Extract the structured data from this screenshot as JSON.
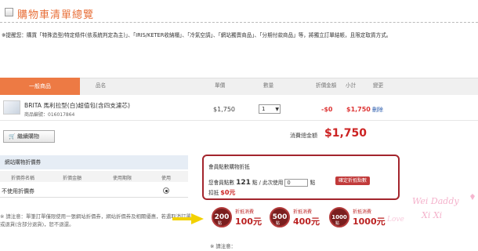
{
  "page": {
    "title": "購物車清單總覽",
    "notice": "※提醒您：購買「特殊造型/特定條件(依系統判定為主)」、「IRIS/KETER收納櫃」、「冷氣空調」、「網站獨賣商品」、「分期付款商品」等，將獨立訂單結帳，且限定取貨方式。"
  },
  "tabs": [
    {
      "label": "一般商品",
      "active": true
    }
  ],
  "table": {
    "headers": [
      "品名",
      "單價",
      "數量",
      "折價金額",
      "小計",
      "變更"
    ],
    "rows": [
      {
        "name": "BRITA 馬利拉型(白)超值包(含四支濾芯)",
        "code": "商品編號：016017864",
        "price": "$1,750",
        "qty": "1",
        "discount": "-$0",
        "subtotal": "$1,750",
        "action": "刪除"
      }
    ]
  },
  "cart": {
    "continue_label": "繼續購物",
    "total_label": "消費總金額",
    "total_value": "$1,750"
  },
  "coupon": {
    "title": "網站購物折價券",
    "headers": [
      "折價券名稱",
      "折價金額",
      "使用期限",
      "使用"
    ],
    "none_label": "不使用折價券",
    "note": "※ 請注意：單筆訂單僅限使用一張網站折價券，網站折價券及相關優惠，若遇取消訂單或退貨(含部分退貨)，恕不退還。"
  },
  "points": {
    "title": "會員點數購物折抵",
    "available_prefix": "您會員點數",
    "available_value": "121",
    "available_suffix": "點 / 此次使用",
    "input_value": "0",
    "input_suffix": "點",
    "confirm_label": "確定折抵點數",
    "deduct_prefix": "扣抵",
    "deduct_value": "$0元"
  },
  "rewards": [
    {
      "points": "200",
      "unit": "點",
      "text": "折抵消費",
      "amount": "100元"
    },
    {
      "points": "500",
      "unit": "點",
      "text": "折抵消費",
      "amount": "400元"
    },
    {
      "points": "1000",
      "unit": "點",
      "text": "折抵消費",
      "amount": "1000元"
    }
  ],
  "watermark": {
    "line1": "Wei Daddy",
    "line2": "Xi Xi",
    "line3": "Love"
  },
  "footer_note": "※ 請注意：",
  "colors": {
    "accent": "#ed7a44",
    "price_red": "#cc2222",
    "box_border": "#a3252d",
    "tab_bar": "#f0f0f0"
  }
}
